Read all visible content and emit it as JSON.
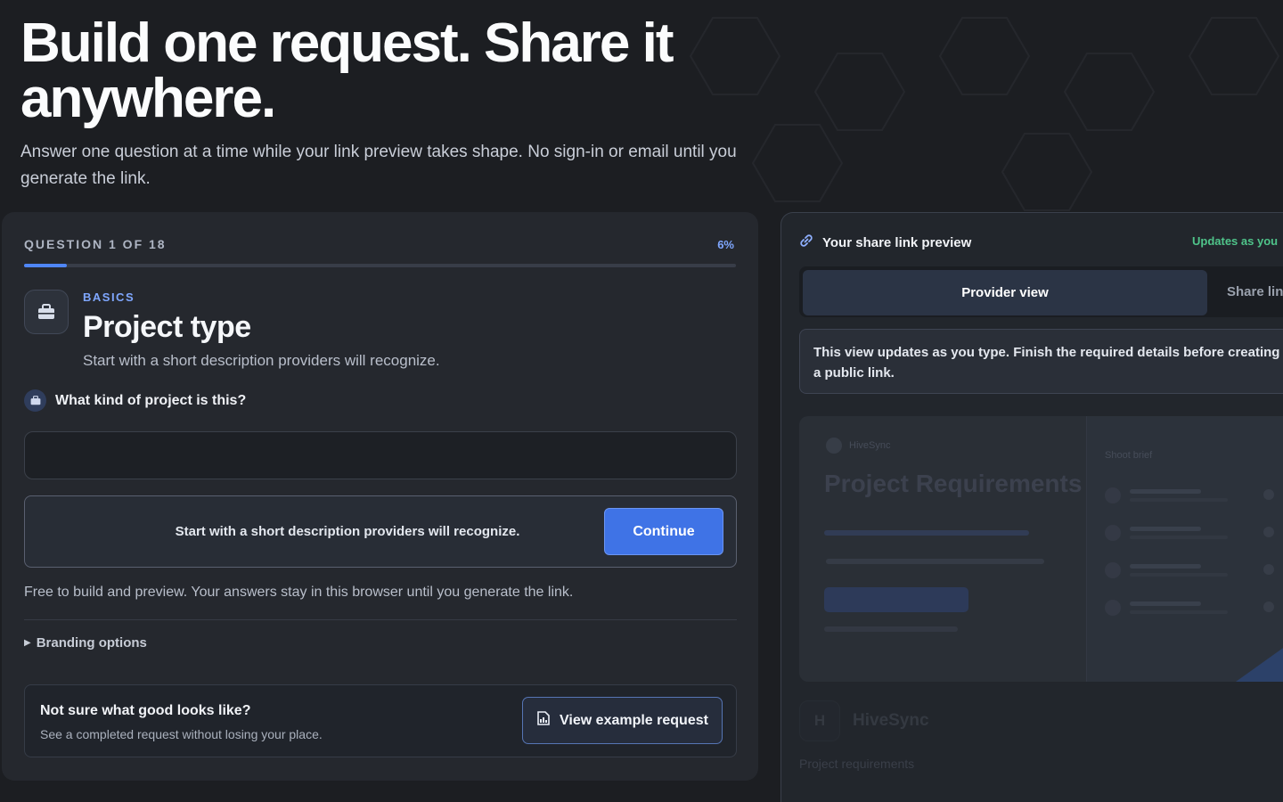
{
  "hero": {
    "title": "Build one request. Share it anywhere.",
    "subtitle": "Answer one question at a time while your link preview takes shape. No sign-in or email until you generate the link."
  },
  "question": {
    "counter": "QUESTION 1 OF 18",
    "percent_label": "6%",
    "progress_fraction": 0.06,
    "eyebrow": "BASICS",
    "title": "Project type",
    "subtitle": "Start with a short description providers will recognize.",
    "icon": "briefcase-icon",
    "prompt": "What kind of project is this?",
    "answer_value": "",
    "answer_placeholder": "",
    "hint": "Start with a short description providers will recognize.",
    "continue_label": "Continue",
    "free_note": "Free to build and preview. Your answers stay in this browser until you generate the link.",
    "branding_label": "Branding options",
    "example_title": "Not sure what good looks like?",
    "example_sub": "See a completed request without losing your place.",
    "example_button": "View example request"
  },
  "preview": {
    "title": "Your share link preview",
    "updates": "Updates as you",
    "tabs": [
      "Provider view",
      "Share lin"
    ],
    "notice": "This view updates as you type. Finish the required details before creating a public link.",
    "mock_brand": "HiveSync",
    "mock_title": "Project Requirements Ready",
    "mock_side_heading": "Shoot brief",
    "hive_initial": "H",
    "hive_name": "HiveSync",
    "hive_sub": "Project requirements"
  },
  "colors": {
    "accent": "#3f73e6",
    "success": "#4fc48a",
    "background": "#1c1e22"
  }
}
